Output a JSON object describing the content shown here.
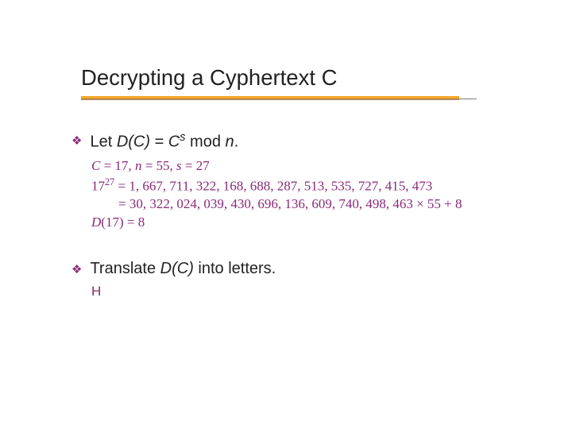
{
  "title": "Decrypting a Cyphertext C",
  "bullet1": {
    "prefix": "Let ",
    "func": "D(C)",
    "eq": " = ",
    "base": "C",
    "sup": "s",
    "mod": " mod ",
    "n": "n",
    "period": "."
  },
  "sub1": {
    "line1_a": "C",
    "line1_b": " = 17,  ",
    "line1_c": "n",
    "line1_d": " = 55,  ",
    "line1_e": "s",
    "line1_f": " = 27",
    "line2_a": "17",
    "line2_sup": "27",
    "line2_b": " = 1, 667, 711, 322, 168, 688, 287, 513, 535, 727, 415, 473",
    "line3": "= 30, 322, 024, 039, 430, 696, 136, 609, 740, 498, 463 × 55 + 8",
    "line4_a": "D",
    "line4_b": "(17) = 8"
  },
  "bullet2": {
    "prefix": "Translate ",
    "func": "D(C)",
    "suffix": " into letters."
  },
  "letters": "H"
}
